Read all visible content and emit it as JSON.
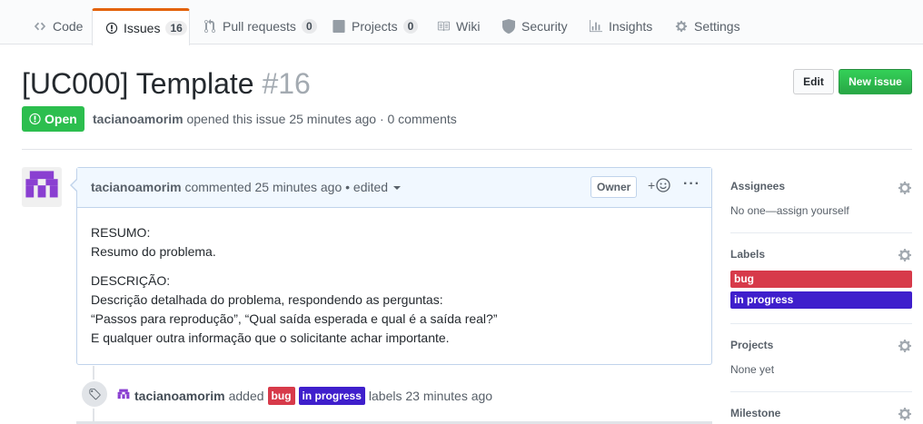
{
  "tabs": [
    {
      "label": "Code",
      "icon": "code-icon"
    },
    {
      "label": "Issues",
      "icon": "issue-opened-icon",
      "count": "16",
      "selected": true
    },
    {
      "label": "Pull requests",
      "icon": "git-pull-request-icon",
      "count": "0"
    },
    {
      "label": "Projects",
      "icon": "project-icon",
      "count": "0"
    },
    {
      "label": "Wiki",
      "icon": "book-icon"
    },
    {
      "label": "Security",
      "icon": "shield-icon"
    },
    {
      "label": "Insights",
      "icon": "graph-icon"
    },
    {
      "label": "Settings",
      "icon": "gear-icon"
    }
  ],
  "issue": {
    "title": "[UC000] Template",
    "number": "#16",
    "state": "Open",
    "author": "tacianoamorim",
    "opened_text": "opened this issue 25 minutes ago · 0 comments",
    "edit_label": "Edit",
    "new_issue_label": "New issue"
  },
  "comment": {
    "author": "tacianoamorim",
    "meta": "commented 25 minutes ago • edited",
    "owner_badge": "Owner",
    "reaction": "+",
    "more": "···",
    "body": {
      "resumo_heading": "RESUMO:",
      "resumo_text": "Resumo do problema.",
      "descricao_heading": "DESCRIÇÃO:",
      "descricao_line1": "Descrição detalhada do problema, respondendo as perguntas:",
      "descricao_line2": "“Passos para reprodução”, “Qual saída esperada e qual é a saída real?”",
      "descricao_line3": "E qualquer outra informação que o solicitante achar importante."
    }
  },
  "timeline_event": {
    "actor": "tacianoamorim",
    "action": "added",
    "labels": [
      {
        "name": "bug",
        "color": "#d73a4a"
      },
      {
        "name": "in progress",
        "color": "#3f1fcc"
      }
    ],
    "suffix": "labels 23 minutes ago"
  },
  "sidebar": {
    "assignees": {
      "heading": "Assignees",
      "value": "No one—assign yourself"
    },
    "labels": {
      "heading": "Labels",
      "items": [
        {
          "name": "bug",
          "color": "#d73a4a"
        },
        {
          "name": "in progress",
          "color": "#3f1fcc"
        }
      ]
    },
    "projects": {
      "heading": "Projects",
      "value": "None yet"
    },
    "milestone": {
      "heading": "Milestone"
    }
  },
  "colors": {
    "accent_tab": "#e36209",
    "open_state": "#2cbe4e",
    "avatar_purple": "#8a3fd1"
  }
}
